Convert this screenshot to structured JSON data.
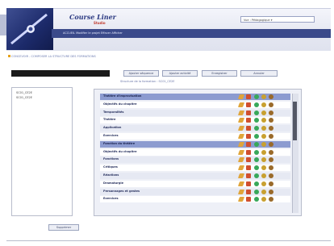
{
  "app": {
    "brand": "Course Liner",
    "brand_sub": "Studio",
    "nav_text": "ACCUEIL  Modifier le projet  Effacer  Afficher",
    "user_label": "Vue : Pédagogique ▾"
  },
  "breadcrumb": "CONCEVOIR - COMPOSER LA STRUCTURE DES FORMATIONS",
  "toolbar": {
    "left_title": "",
    "buttons": [
      "Ajouter séquence",
      "Ajouter activité",
      "Enregistrer",
      "Annuler"
    ]
  },
  "subtitle": "Structure de la formation : SC01_CE2E",
  "left_panel": {
    "items": [
      "SC01_CE2E",
      "SC01_CE2E"
    ]
  },
  "rows": [
    {
      "label": "Théâtre d'improvisation",
      "type": "section"
    },
    {
      "label": "Objectifs du chapitre",
      "type": "odd"
    },
    {
      "label": "Temporalités",
      "type": "even"
    },
    {
      "label": "Théâtre",
      "type": "odd"
    },
    {
      "label": "Application",
      "type": "even"
    },
    {
      "label": "Exercices",
      "type": "odd"
    },
    {
      "label": "Fonction du théâtre",
      "type": "section"
    },
    {
      "label": "Objectifs du chapitre",
      "type": "odd"
    },
    {
      "label": "Fonctions",
      "type": "even"
    },
    {
      "label": "Critiques",
      "type": "odd"
    },
    {
      "label": "Réactions",
      "type": "even"
    },
    {
      "label": "Dramaturgie",
      "type": "odd"
    },
    {
      "label": "Personnages et gestes",
      "type": "even"
    },
    {
      "label": "Exercices",
      "type": "odd"
    }
  ],
  "bottom_button": "Supprimer"
}
